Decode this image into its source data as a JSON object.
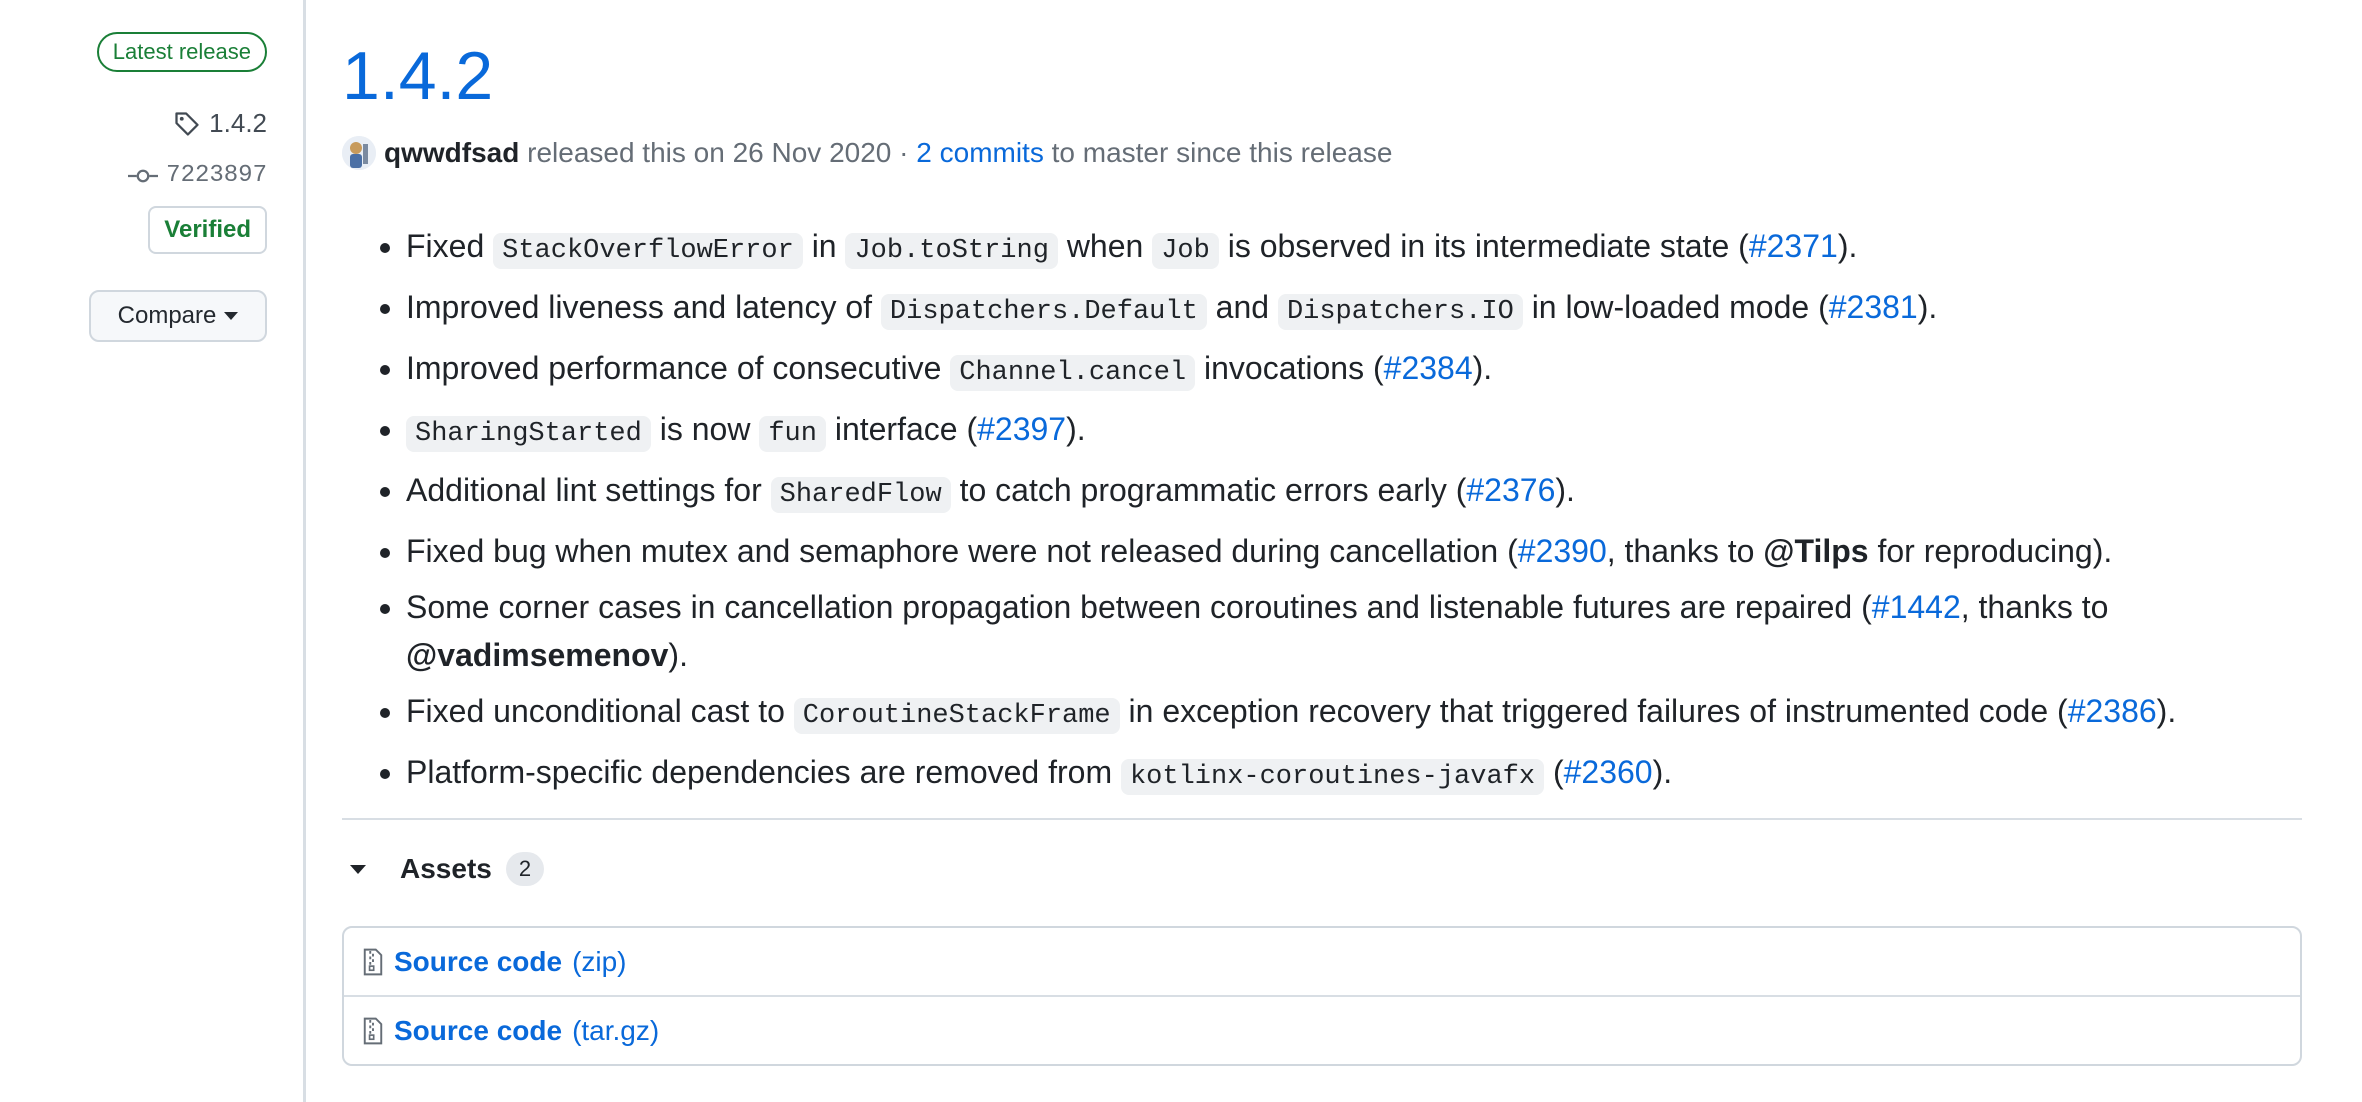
{
  "sidebar": {
    "latest_badge": "Latest release",
    "tag": "1.4.2",
    "commit": "7223897",
    "verified": "Verified",
    "compare": "Compare"
  },
  "release": {
    "title": "1.4.2",
    "author": "qwwdfsad",
    "released_text": "released this on 26 Nov 2020 ·",
    "commits_link": "2 commits",
    "commits_suffix": "to master since this release"
  },
  "notes": [
    {
      "id": "note-stackoverflow",
      "parts": [
        {
          "t": "text",
          "v": "Fixed "
        },
        {
          "t": "code",
          "v": "StackOverflowError"
        },
        {
          "t": "text",
          "v": " in "
        },
        {
          "t": "code",
          "v": "Job.toString"
        },
        {
          "t": "text",
          "v": " when "
        },
        {
          "t": "code",
          "v": "Job"
        },
        {
          "t": "text",
          "v": " is observed in its intermediate state ("
        },
        {
          "t": "link",
          "v": "#2371"
        },
        {
          "t": "text",
          "v": ")."
        }
      ]
    },
    {
      "id": "note-dispatchers",
      "parts": [
        {
          "t": "text",
          "v": "Improved liveness and latency of "
        },
        {
          "t": "code",
          "v": "Dispatchers.Default"
        },
        {
          "t": "text",
          "v": " and "
        },
        {
          "t": "code",
          "v": "Dispatchers.IO"
        },
        {
          "t": "text",
          "v": " in low-loaded mode ("
        },
        {
          "t": "link",
          "v": "#2381"
        },
        {
          "t": "text",
          "v": ")."
        }
      ]
    },
    {
      "id": "note-channel-cancel",
      "parts": [
        {
          "t": "text",
          "v": "Improved performance of consecutive "
        },
        {
          "t": "code",
          "v": "Channel.cancel"
        },
        {
          "t": "text",
          "v": " invocations ("
        },
        {
          "t": "link",
          "v": "#2384"
        },
        {
          "t": "text",
          "v": ")."
        }
      ]
    },
    {
      "id": "note-sharingstarted",
      "parts": [
        {
          "t": "code",
          "v": "SharingStarted"
        },
        {
          "t": "text",
          "v": " is now "
        },
        {
          "t": "code",
          "v": "fun"
        },
        {
          "t": "text",
          "v": " interface ("
        },
        {
          "t": "link",
          "v": "#2397"
        },
        {
          "t": "text",
          "v": ")."
        }
      ]
    },
    {
      "id": "note-lint",
      "parts": [
        {
          "t": "text",
          "v": "Additional lint settings for "
        },
        {
          "t": "code",
          "v": "SharedFlow"
        },
        {
          "t": "text",
          "v": " to catch programmatic errors early ("
        },
        {
          "t": "link",
          "v": "#2376"
        },
        {
          "t": "text",
          "v": ")."
        }
      ]
    },
    {
      "id": "note-mutex",
      "parts": [
        {
          "t": "text",
          "v": "Fixed bug when mutex and semaphore were not released during cancellation ("
        },
        {
          "t": "link",
          "v": "#2390"
        },
        {
          "t": "text",
          "v": ", thanks to "
        },
        {
          "t": "bold",
          "v": "@Tilps"
        },
        {
          "t": "text",
          "v": " for reproducing)."
        }
      ]
    },
    {
      "id": "note-listenable",
      "parts": [
        {
          "t": "text",
          "v": "Some corner cases in cancellation propagation between coroutines and listenable futures are repaired ("
        },
        {
          "t": "link",
          "v": "#1442"
        },
        {
          "t": "text",
          "v": ", thanks to "
        },
        {
          "t": "bold",
          "v": "@vadimsemenov"
        },
        {
          "t": "text",
          "v": ")."
        }
      ]
    },
    {
      "id": "note-cast",
      "parts": [
        {
          "t": "text",
          "v": "Fixed unconditional cast to "
        },
        {
          "t": "code",
          "v": "CoroutineStackFrame"
        },
        {
          "t": "text",
          "v": " in exception recovery that triggered failures of instrumented code ("
        },
        {
          "t": "link",
          "v": "#2386"
        },
        {
          "t": "text",
          "v": ")."
        }
      ]
    },
    {
      "id": "note-javafx",
      "parts": [
        {
          "t": "text",
          "v": "Platform-specific dependencies are removed from "
        },
        {
          "t": "code",
          "v": "kotlinx-coroutines-javafx"
        },
        {
          "t": "text",
          "v": " ("
        },
        {
          "t": "link",
          "v": "#2360"
        },
        {
          "t": "text",
          "v": ")."
        }
      ]
    }
  ],
  "assets": {
    "heading": "Assets",
    "count": "2",
    "items": [
      {
        "name": "Source code",
        "ext": "(zip)",
        "icon": "file-zip-icon"
      },
      {
        "name": "Source code",
        "ext": "(tar.gz)",
        "icon": "file-zip-icon"
      }
    ]
  },
  "colors": {
    "link": "#0969da",
    "verified": "#1a7f37",
    "text": "#1f2328",
    "muted": "#656d76"
  }
}
